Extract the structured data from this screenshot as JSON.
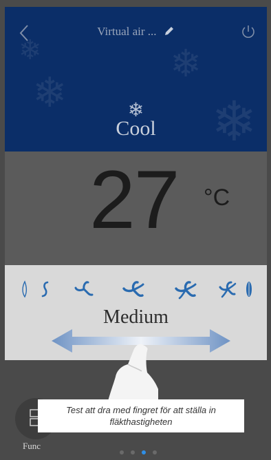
{
  "header": {
    "title": "Virtual air ...",
    "back_icon": "chevron-left-icon",
    "edit_icon": "pencil-icon",
    "power_icon": "power-icon"
  },
  "mode": {
    "label": "Cool",
    "icon": "snowflake-icon"
  },
  "temperature": {
    "value": "27",
    "unit": "°C"
  },
  "fan": {
    "speed_label": "Medium",
    "levels": [
      "level-1",
      "level-2",
      "level-3",
      "level-4",
      "level-5",
      "level-6",
      "level-7"
    ],
    "accent_color": "#2a6bb0"
  },
  "bottom": {
    "func_label": "Func",
    "page_count": 4,
    "active_page": 3
  },
  "hint": {
    "text": "Test att dra med fingret för att ställa in fläkthastigheten"
  },
  "colors": {
    "header_bg": "#0b2e68",
    "panel_bg": "#d9d9d9",
    "body_bg": "#4a4a4a"
  }
}
